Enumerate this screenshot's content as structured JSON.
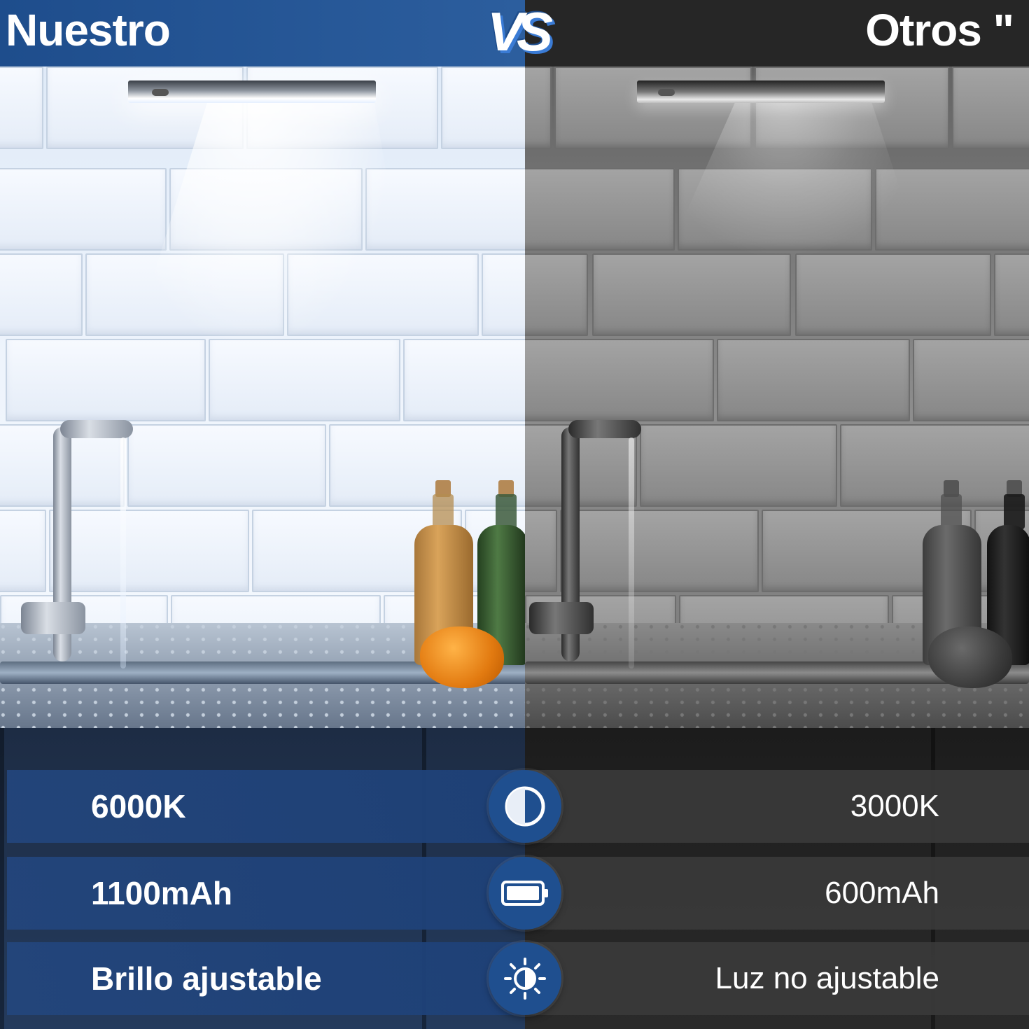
{
  "header": {
    "left_title": "Nuestro",
    "vs_label": "VS",
    "right_title": "Otros \""
  },
  "comparison": [
    {
      "icon": "contrast-icon",
      "ours": "6000K",
      "others": "3000K"
    },
    {
      "icon": "battery-icon",
      "ours": "1100mAh",
      "others": "600mAh"
    },
    {
      "icon": "brightness-icon",
      "ours": "Brillo ajustable",
      "others": "Luz no ajustable"
    }
  ],
  "colors": {
    "accent_blue": "#1e4d8c",
    "row_blue": "#23467d",
    "row_gray": "#3a3a3a",
    "text": "#ffffff"
  }
}
